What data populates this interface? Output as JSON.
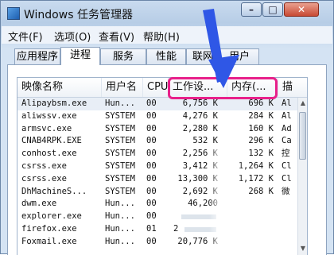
{
  "window": {
    "title": "Windows 任务管理器"
  },
  "menu": [
    "文件(F)",
    "选项(O)",
    "查看(V)",
    "帮助(H)"
  ],
  "tabs": [
    "应用程序",
    "进程",
    "服务",
    "性能",
    "联网",
    "用户"
  ],
  "active_tab": "进程",
  "columns": {
    "name": "映像名称",
    "user": "用户名",
    "cpu": "CPU",
    "work": "工作设...",
    "mem": "内存(...",
    "desc": "描"
  },
  "rows": [
    {
      "name": "Alipaybsm.exe",
      "user": "Hun...",
      "cpu": "00",
      "work": "6,756 K",
      "mem": "696 K",
      "desc": "Al"
    },
    {
      "name": "aliwssv.exe",
      "user": "SYSTEM",
      "cpu": "00",
      "work": "4,276 K",
      "mem": "284 K",
      "desc": "Al"
    },
    {
      "name": "armsvc.exe",
      "user": "SYSTEM",
      "cpu": "00",
      "work": "2,280 K",
      "mem": "160 K",
      "desc": "Ad"
    },
    {
      "name": "CNAB4RPK.EXE",
      "user": "SYSTEM",
      "cpu": "00",
      "work": "532 K",
      "mem": "296 K",
      "desc": "Ca"
    },
    {
      "name": "conhost.exe",
      "user": "SYSTEM",
      "cpu": "00",
      "work": "2,256 K",
      "mem": "132 K",
      "desc": "控"
    },
    {
      "name": "csrss.exe",
      "user": "SYSTEM",
      "cpu": "00",
      "work": "3,412 K",
      "mem": "1,264 K",
      "desc": "Cl"
    },
    {
      "name": "csrss.exe",
      "user": "SYSTEM",
      "cpu": "00",
      "work": "13,300 K",
      "mem": "1,172 K",
      "desc": "Cl"
    },
    {
      "name": "DhMachineS...",
      "user": "SYSTEM",
      "cpu": "00",
      "work": "2,692 K",
      "mem": "268 K",
      "desc": "微"
    },
    {
      "name": "dwm.exe",
      "user": "Hun...",
      "cpu": "00",
      "work": "46,200",
      "mem": "",
      "desc": ""
    },
    {
      "name": "explorer.exe",
      "user": "Hun...",
      "cpu": "00",
      "work": "",
      "mem": "",
      "desc": ""
    },
    {
      "name": "firefox.exe",
      "user": "Hun...",
      "cpu": "01",
      "work": "2",
      "mem": "",
      "desc": ""
    },
    {
      "name": "Foxmail.exe",
      "user": "Hun...",
      "cpu": "00",
      "work": "20,776 K",
      "mem": "",
      "desc": ""
    }
  ],
  "colors": {
    "highlight": "#e8208a",
    "arrow": "#2f57e6"
  },
  "icons": {
    "app": "task-manager-icon"
  }
}
